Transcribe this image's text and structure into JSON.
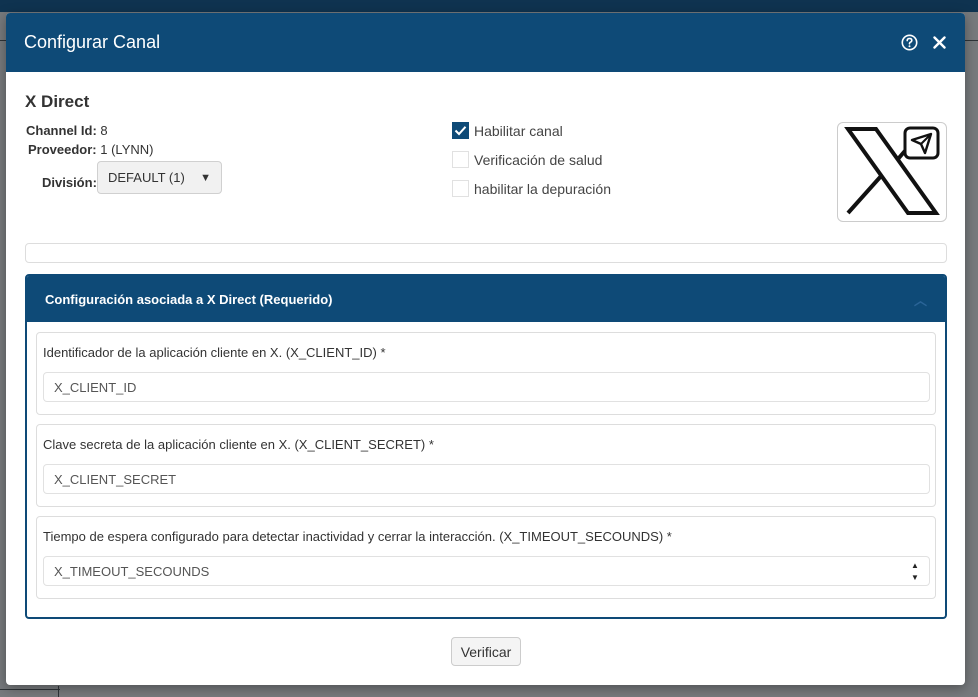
{
  "dialog": {
    "title": "Configurar Canal",
    "help_icon": "help-circle-icon",
    "close_icon": "close-icon"
  },
  "channel": {
    "name": "X Direct",
    "id_label": "Channel Id:",
    "id_value": "8",
    "provider_label": "Proveedor:",
    "provider_value": "1 (LYNN)",
    "division_label": "División:",
    "division_value": "DEFAULT (1)",
    "logo_icon": "x-logo-send-icon"
  },
  "options": [
    {
      "label": "Habilitar canal",
      "checked": true
    },
    {
      "label": "Verificación de salud",
      "checked": false
    },
    {
      "label": "habilitar la depuración",
      "checked": false
    }
  ],
  "config_panel": {
    "title": "Configuración asociada a X Direct (Requerido)",
    "fields": [
      {
        "label": "Identificador de la aplicación cliente en X. (X_CLIENT_ID) *",
        "placeholder": "X_CLIENT_ID",
        "value": ""
      },
      {
        "label": "Clave secreta de la aplicación cliente en X. (X_CLIENT_SECRET) *",
        "placeholder": "X_CLIENT_SECRET",
        "value": ""
      },
      {
        "label": "Tiempo de espera configurado para detectar inactividad y cerrar la interacción. (X_TIMEOUT_SECOUNDS) *",
        "placeholder": "X_TIMEOUT_SECOUNDS",
        "value": ""
      }
    ]
  },
  "actions": {
    "verify_label": "Verificar"
  },
  "colors": {
    "primary": "#0e4a77",
    "overlay": "#6b6b6b"
  }
}
